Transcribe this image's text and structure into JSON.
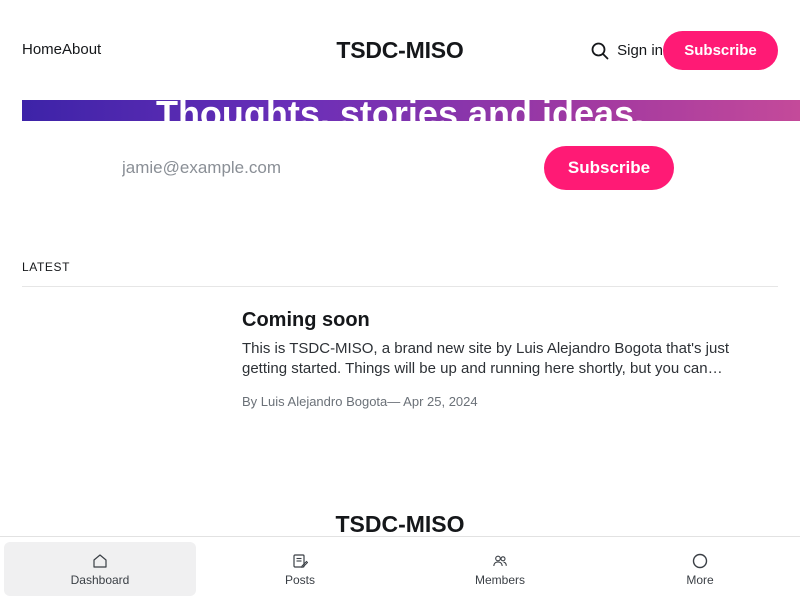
{
  "header": {
    "nav": [
      {
        "label": "Home"
      },
      {
        "label": "About"
      }
    ],
    "brand": "TSDC-MISO",
    "signin_label": "Sign in",
    "subscribe_label": "Subscribe",
    "search_icon": "search-icon"
  },
  "hero": {
    "title": "Thoughts, stories and ideas."
  },
  "subscribe_form": {
    "email_placeholder": "jamie@example.com",
    "email_value": "",
    "button_label": "Subscribe"
  },
  "latest": {
    "label": "LATEST",
    "posts": [
      {
        "title": "Coming soon",
        "excerpt": "This is TSDC-MISO, a brand new site by Luis Alejandro Bogota that's just getting started. Things will be up and running here shortly, but you can subscribe in the meantime if you'd like to stay up to date and receive emails when new content is published!",
        "author": "By Luis Alejandro Bogota",
        "date": "— Apr 25, 2024"
      }
    ]
  },
  "footer": {
    "brand": "TSDC-MISO"
  },
  "tabbar": {
    "tabs": [
      {
        "label": "Dashboard",
        "icon": "home-icon",
        "active": true
      },
      {
        "label": "Posts",
        "icon": "posts-icon",
        "active": false
      },
      {
        "label": "Members",
        "icon": "members-icon",
        "active": false
      },
      {
        "label": "More",
        "icon": "more-icon",
        "active": false
      }
    ]
  },
  "colors": {
    "accent": "#ff1a75",
    "hero_gradient_start": "#3d23a8",
    "hero_gradient_end": "#c44a9a"
  }
}
